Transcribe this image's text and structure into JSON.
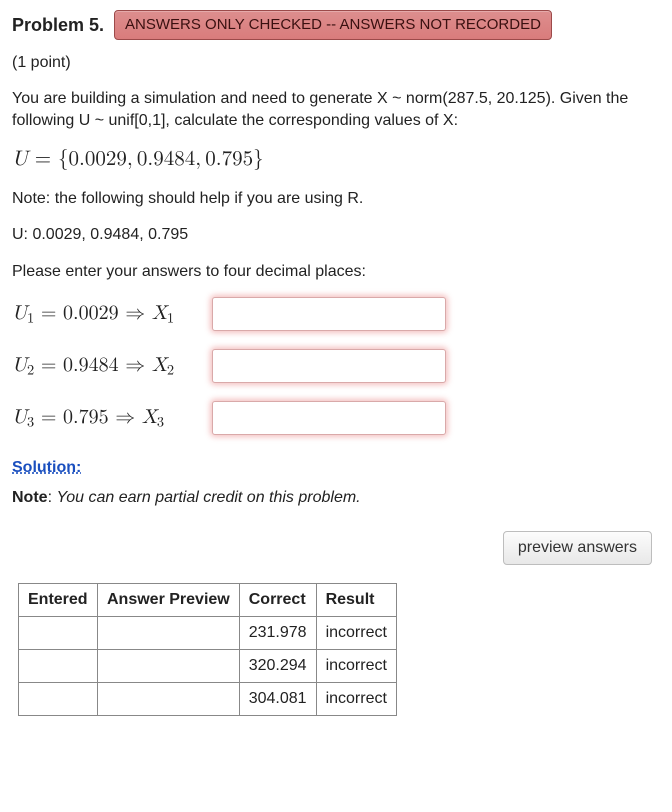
{
  "header": {
    "problem_label": "Problem 5.",
    "status_badge": "ANSWERS ONLY CHECKED -- ANSWERS NOT RECORDED",
    "points": "(1 point)"
  },
  "prompt": {
    "intro": "You are building a simulation and need to generate X ~ norm(287.5, 20.125). Given the following U ~ unif[0,1], calculate the corresponding values of X:",
    "U_set_formula": "U = {0.0029, 0.9484, 0.795}",
    "note_r": "Note: the following should help if you are using R.",
    "u_values_line": "U: 0.0029, 0.9484, 0.795",
    "decimal_note": "Please enter your answers to four decimal places:"
  },
  "answers": [
    {
      "lhs_sub": "1",
      "u_val": "0.0029",
      "x_sub": "1",
      "value": ""
    },
    {
      "lhs_sub": "2",
      "u_val": "0.9484",
      "x_sub": "2",
      "value": ""
    },
    {
      "lhs_sub": "3",
      "u_val": "0.795",
      "x_sub": "3",
      "value": ""
    }
  ],
  "solution": {
    "link_label": "Solution:",
    "note_bold": "Note",
    "note_italic": "You can earn partial credit on this problem."
  },
  "buttons": {
    "preview": "preview answers"
  },
  "results_table": {
    "headers": [
      "Entered",
      "Answer Preview",
      "Correct",
      "Result"
    ],
    "rows": [
      {
        "entered": "",
        "preview": "",
        "correct": "231.978",
        "result": "incorrect"
      },
      {
        "entered": "",
        "preview": "",
        "correct": "320.294",
        "result": "incorrect"
      },
      {
        "entered": "",
        "preview": "",
        "correct": "304.081",
        "result": "incorrect"
      }
    ]
  }
}
